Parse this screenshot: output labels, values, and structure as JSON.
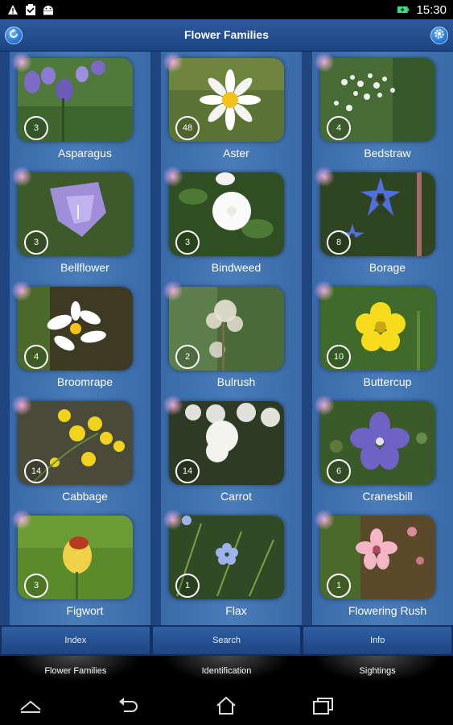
{
  "status_bar": {
    "time": "15:30",
    "icons": [
      "warning-icon",
      "clipboard-icon",
      "android-icon",
      "battery-charging-icon"
    ]
  },
  "header": {
    "title": "Flower Families",
    "left_button": "refresh-icon",
    "right_button": "settings-icon"
  },
  "families": [
    {
      "name": "Asparagus",
      "count": "3",
      "photo": "purple-bell-flowers"
    },
    {
      "name": "Aster",
      "count": "48",
      "photo": "white-daisy"
    },
    {
      "name": "Bedstraw",
      "count": "4",
      "photo": "white-tiny-flowers"
    },
    {
      "name": "Bellflower",
      "count": "3",
      "photo": "lilac-bellflower"
    },
    {
      "name": "Bindweed",
      "count": "3",
      "photo": "white-trumpet-flower"
    },
    {
      "name": "Borage",
      "count": "8",
      "photo": "blue-star-flower"
    },
    {
      "name": "Broomrape",
      "count": "4",
      "photo": "white-lobed-flower"
    },
    {
      "name": "Bulrush",
      "count": "2",
      "photo": "fluffy-seed-head"
    },
    {
      "name": "Buttercup",
      "count": "10",
      "photo": "yellow-buttercup"
    },
    {
      "name": "Cabbage",
      "count": "14",
      "photo": "yellow-small-flowers"
    },
    {
      "name": "Carrot",
      "count": "14",
      "photo": "white-umbel"
    },
    {
      "name": "Cranesbill",
      "count": "6",
      "photo": "violet-geranium"
    },
    {
      "name": "Figwort",
      "count": "3",
      "photo": "yellow-red-snapdragon"
    },
    {
      "name": "Flax",
      "count": "1",
      "photo": "pale-blue-flax"
    },
    {
      "name": "Flowering Rush",
      "count": "1",
      "photo": "pink-rush-flower"
    }
  ],
  "tabs_top": [
    "Index",
    "Search",
    "Info"
  ],
  "tabs_bottom": [
    "Flower Families",
    "Identification",
    "Sightings"
  ],
  "nav": [
    "back-caret-icon",
    "back-arrow-icon",
    "home-icon",
    "recent-apps-icon"
  ]
}
